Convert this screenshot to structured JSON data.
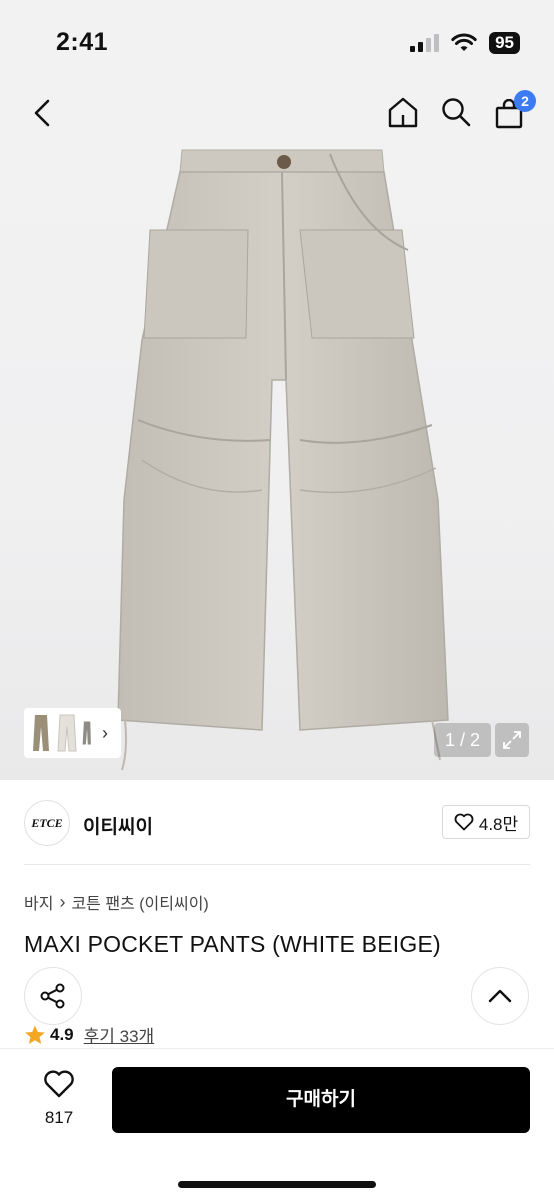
{
  "status": {
    "time": "2:41",
    "battery": "95"
  },
  "nav": {
    "cart_badge": "2"
  },
  "gallery": {
    "counter": "1 / 2"
  },
  "brand": {
    "logo_text": "ETCE",
    "name": "이티씨이",
    "likes": "4.8만"
  },
  "breadcrumb": {
    "category": "바지",
    "subcategory": "코튼 팬츠 (이티씨이)"
  },
  "product": {
    "title": "MAXI POCKET PANTS (WHITE BEIGE)"
  },
  "rating": {
    "value": "4.9",
    "reviews": "후기 33개"
  },
  "bottom": {
    "wish_count": "817",
    "buy_label": "구매하기"
  },
  "colors": {
    "accent": "#3d7bf4",
    "star": "#f5a623",
    "product": "#cfcbc3"
  }
}
